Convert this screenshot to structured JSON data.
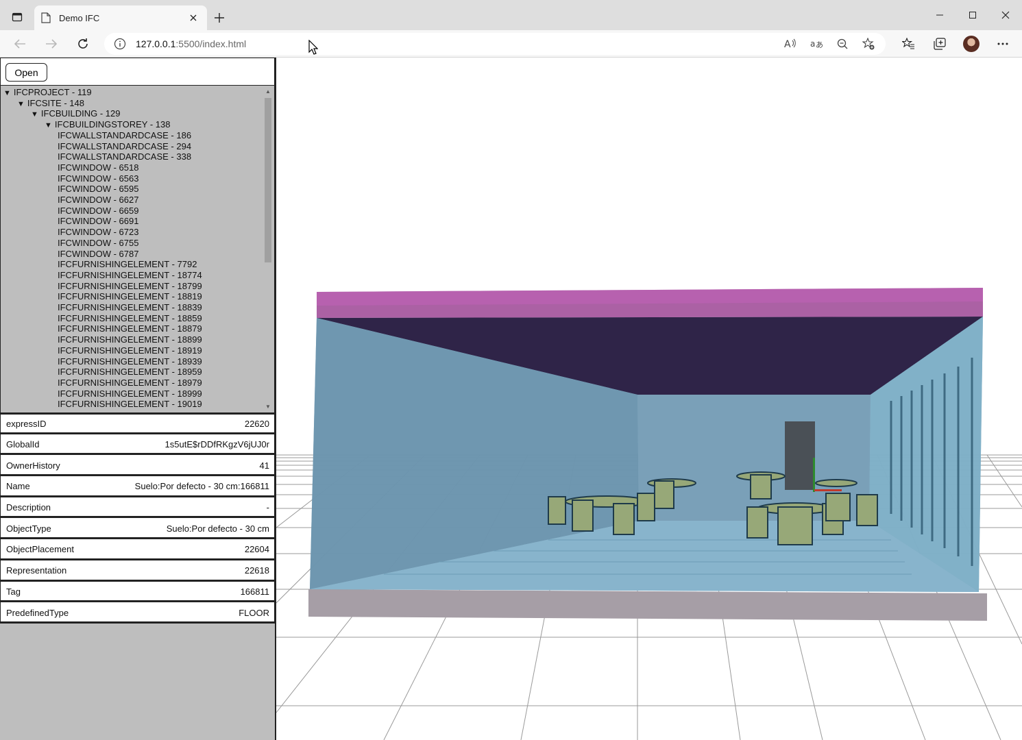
{
  "browser": {
    "tab_title": "Demo IFC",
    "url_host": "127.0.0.1",
    "url_rest": ":5500/index.html"
  },
  "panel": {
    "open_label": "Open",
    "tree": [
      {
        "label": "IFCPROJECT - 119",
        "depth": 0,
        "expanded": true
      },
      {
        "label": "IFCSITE - 148",
        "depth": 1,
        "expanded": true
      },
      {
        "label": "IFCBUILDING - 129",
        "depth": 2,
        "expanded": true
      },
      {
        "label": "IFCBUILDINGSTOREY - 138",
        "depth": 3,
        "expanded": true
      },
      {
        "label": "IFCWALLSTANDARDCASE - 186",
        "depth": 4
      },
      {
        "label": "IFCWALLSTANDARDCASE - 294",
        "depth": 4
      },
      {
        "label": "IFCWALLSTANDARDCASE - 338",
        "depth": 4
      },
      {
        "label": "IFCWINDOW - 6518",
        "depth": 4
      },
      {
        "label": "IFCWINDOW - 6563",
        "depth": 4
      },
      {
        "label": "IFCWINDOW - 6595",
        "depth": 4
      },
      {
        "label": "IFCWINDOW - 6627",
        "depth": 4
      },
      {
        "label": "IFCWINDOW - 6659",
        "depth": 4
      },
      {
        "label": "IFCWINDOW - 6691",
        "depth": 4
      },
      {
        "label": "IFCWINDOW - 6723",
        "depth": 4
      },
      {
        "label": "IFCWINDOW - 6755",
        "depth": 4
      },
      {
        "label": "IFCWINDOW - 6787",
        "depth": 4
      },
      {
        "label": "IFCFURNISHINGELEMENT - 7792",
        "depth": 4
      },
      {
        "label": "IFCFURNISHINGELEMENT - 18774",
        "depth": 4
      },
      {
        "label": "IFCFURNISHINGELEMENT - 18799",
        "depth": 4
      },
      {
        "label": "IFCFURNISHINGELEMENT - 18819",
        "depth": 4
      },
      {
        "label": "IFCFURNISHINGELEMENT - 18839",
        "depth": 4
      },
      {
        "label": "IFCFURNISHINGELEMENT - 18859",
        "depth": 4
      },
      {
        "label": "IFCFURNISHINGELEMENT - 18879",
        "depth": 4
      },
      {
        "label": "IFCFURNISHINGELEMENT - 18899",
        "depth": 4
      },
      {
        "label": "IFCFURNISHINGELEMENT - 18919",
        "depth": 4
      },
      {
        "label": "IFCFURNISHINGELEMENT - 18939",
        "depth": 4
      },
      {
        "label": "IFCFURNISHINGELEMENT - 18959",
        "depth": 4
      },
      {
        "label": "IFCFURNISHINGELEMENT - 18979",
        "depth": 4
      },
      {
        "label": "IFCFURNISHINGELEMENT - 18999",
        "depth": 4
      },
      {
        "label": "IFCFURNISHINGELEMENT - 19019",
        "depth": 4
      }
    ],
    "properties": [
      {
        "key": "expressID",
        "value": "22620"
      },
      {
        "key": "GlobalId",
        "value": "1s5utE$rDDfRKgzV6jUJ0r"
      },
      {
        "key": "OwnerHistory",
        "value": "41"
      },
      {
        "key": "Name",
        "value": "Suelo:Por defecto - 30 cm:166811"
      },
      {
        "key": "Description",
        "value": "-"
      },
      {
        "key": "ObjectType",
        "value": "Suelo:Por defecto - 30 cm"
      },
      {
        "key": "ObjectPlacement",
        "value": "22604"
      },
      {
        "key": "Representation",
        "value": "22618"
      },
      {
        "key": "Tag",
        "value": "166811"
      },
      {
        "key": "PredefinedType",
        "value": "FLOOR"
      }
    ]
  },
  "colors": {
    "panel_bg": "#bebebe",
    "roof": "#a2509a",
    "glass": "#6f9cb4",
    "floor": "#a09aa0",
    "furniture": "#97a878"
  }
}
